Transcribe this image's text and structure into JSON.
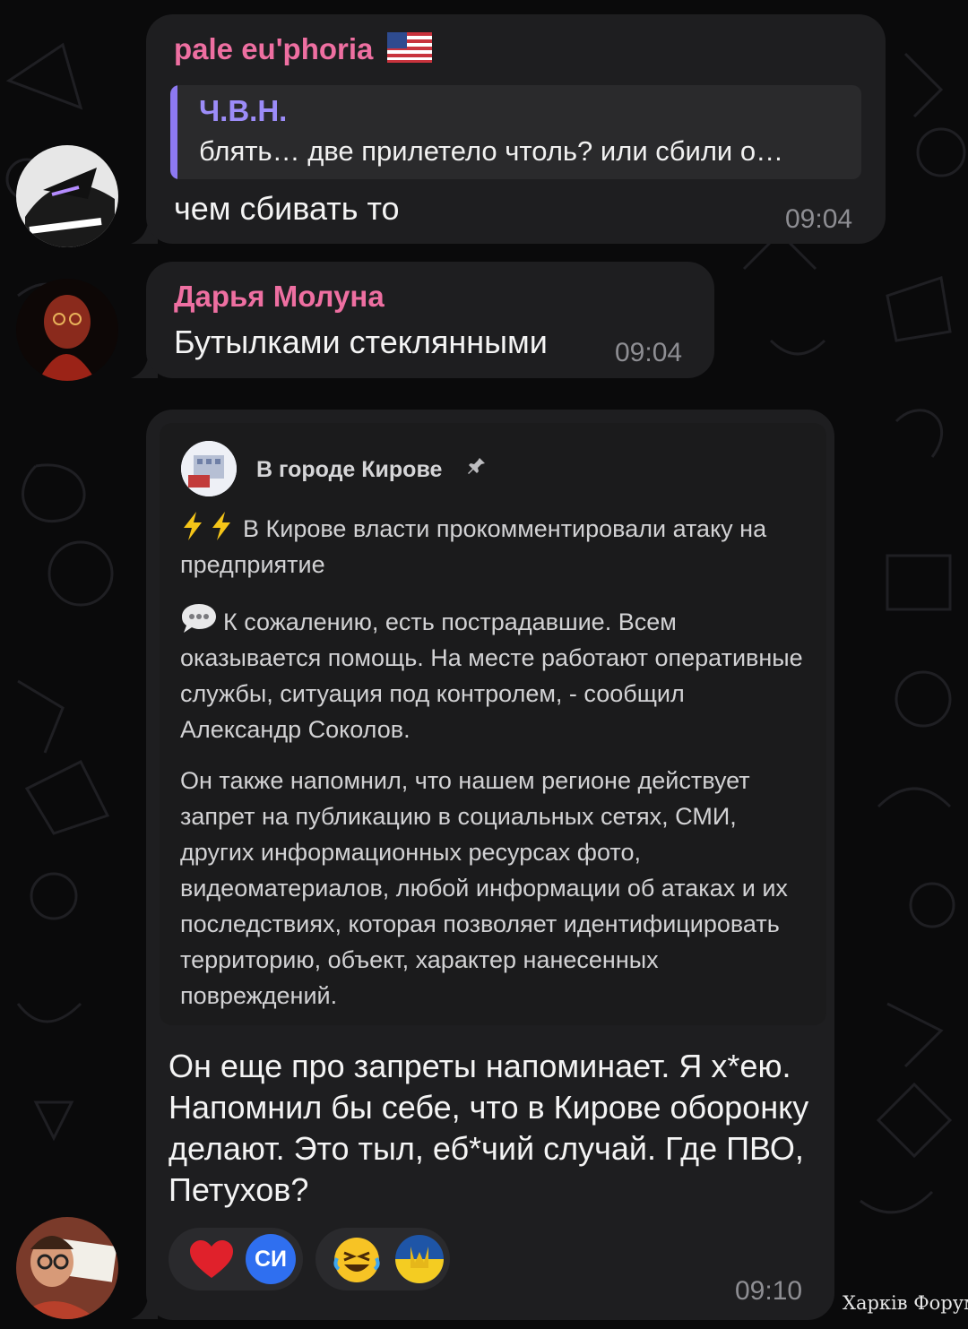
{
  "messages": [
    {
      "sender": "pale eu'phoria",
      "sender_flag": "us-flag-icon",
      "reply_to": {
        "author": "Ч.В.Н.",
        "text": "блять… две прилетело чтоль? или сбили о…"
      },
      "text": "чем сбивать то",
      "time": "09:04"
    },
    {
      "sender": "Дарья Молуна",
      "text": "Бутылками стеклянными",
      "time": "09:04"
    },
    {
      "forwarded": {
        "channel_name": "В городе Кирове",
        "pin_icon": "pin-icon",
        "headline_icon": "lightning-icon",
        "headline": "В Кирове власти прокомментировали атаку на предприятие",
        "quote_icon": "speech-bubble-icon",
        "paragraph1": "К сожалению, есть пострадавшие. Всем оказывается помощь. На месте работают оперативные службы, ситуация под контролем, - сообщил Александр Соколов.",
        "paragraph2": "Он также напомнил, что нашем регионе действует запрет на публикацию в социальных сетях, СМИ, других информационных ресурсах фото, видеоматериалов, любой информации об атаках и их последствиях, которая позволяет идентифицировать территорию, объект, характер нанесенных повреждений."
      },
      "text": "Он еще про запреты напоминает. Я х*ею. Напомнил бы себе, что в Кирове оборонку делают. Это тыл, еб*чий случай. Где ПВО, Петухов?",
      "reactions": [
        {
          "emoji": "heart-icon",
          "reactor": "СИ"
        },
        {
          "emoji": "rofl-emoji-icon",
          "reactor": "ukraine-coat-of-arms-icon"
        }
      ],
      "time": "09:10"
    }
  ],
  "watermark": "Харків Форум",
  "colors": {
    "background": "#0a0a0b",
    "bubble": "#1e1e20",
    "sender_name": "#ee6fa1",
    "quote_bar": "#8d79f2",
    "timestamp": "#8e8e93",
    "reaction_badge": "#2f6ff0"
  }
}
